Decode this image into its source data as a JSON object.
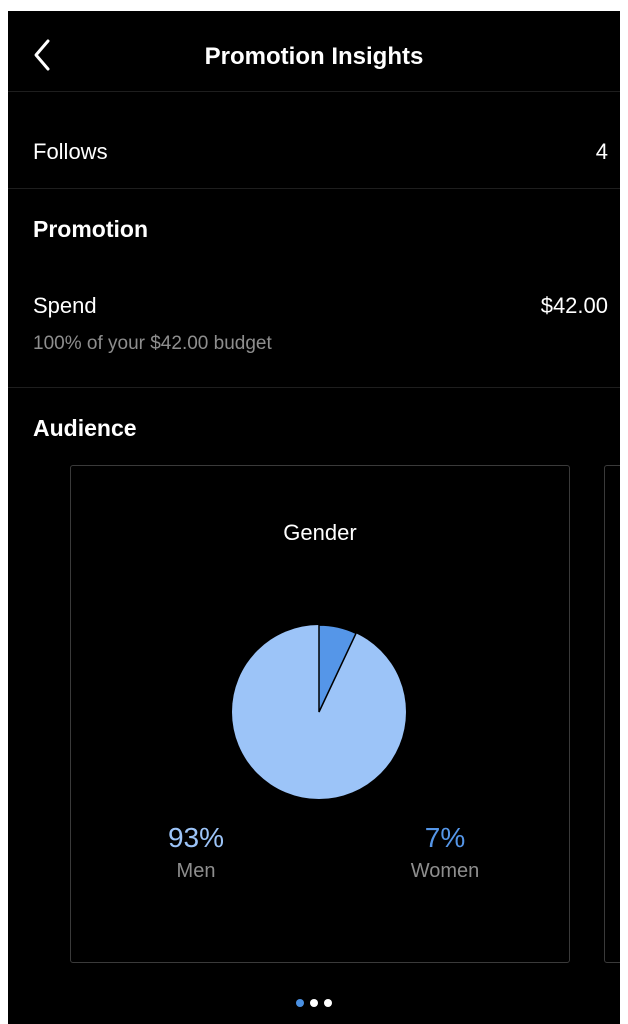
{
  "header": {
    "title": "Promotion Insights",
    "back_icon": "chevron-left-icon"
  },
  "follows": {
    "label": "Follows",
    "value": "4"
  },
  "promotion": {
    "title": "Promotion",
    "spend_label": "Spend",
    "spend_value": "$42.00",
    "budget_note": "100% of your $42.00 budget"
  },
  "audience": {
    "title": "Audience",
    "card": {
      "title": "Gender",
      "men": {
        "percent": "93%",
        "label": "Men",
        "value": 93,
        "color": "#9cc4f8"
      },
      "women": {
        "percent": "7%",
        "label": "Women",
        "value": 7,
        "color": "#5596e8"
      }
    },
    "pager": {
      "count": 3,
      "active": 0,
      "active_color": "#4a90e2",
      "inactive_color": "#ffffff"
    }
  }
}
